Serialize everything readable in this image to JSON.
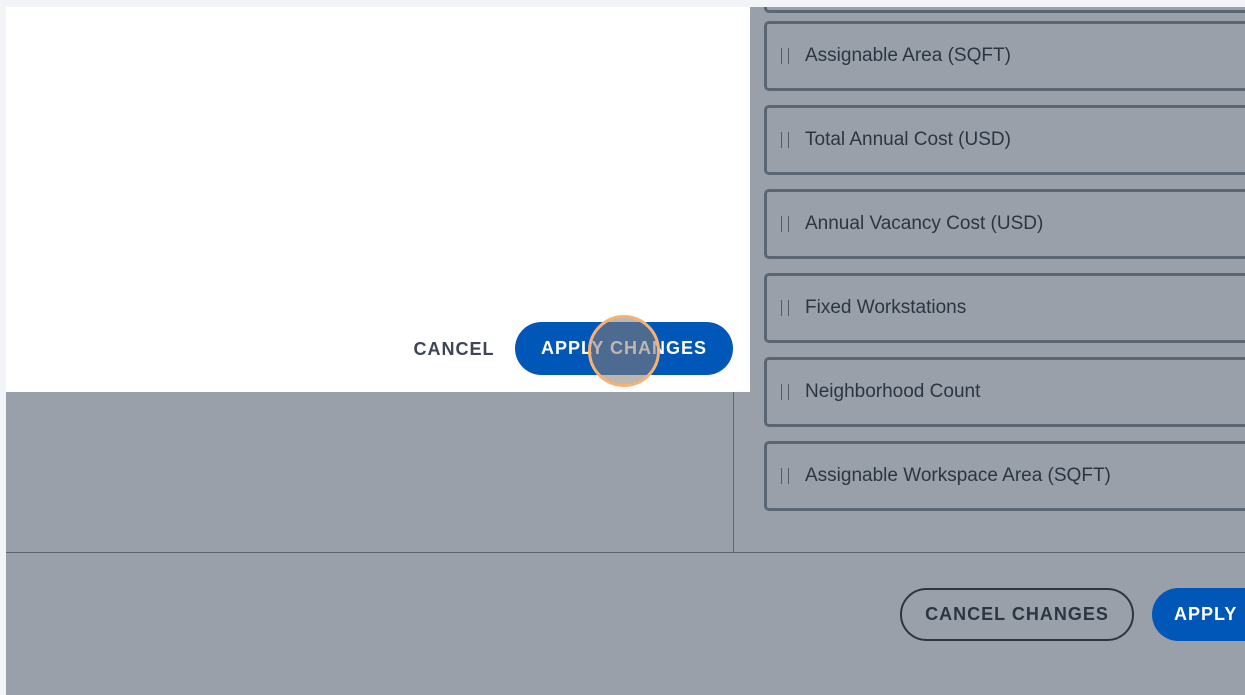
{
  "columns": {
    "items": [
      {
        "label": "Assignable Area (SQFT)"
      },
      {
        "label": "Total Annual Cost (USD)"
      },
      {
        "label": "Annual Vacancy Cost (USD)"
      },
      {
        "label": "Fixed Workstations"
      },
      {
        "label": "Neighborhood Count"
      },
      {
        "label": "Assignable Workspace Area (SQFT)"
      }
    ]
  },
  "dialog": {
    "cancel_label": "CANCEL",
    "apply_label": "APPLY CHANGES"
  },
  "footer": {
    "cancel_label": "CANCEL CHANGES",
    "apply_label": "APPLY"
  },
  "colors": {
    "primary": "#0057b8",
    "overlay": "#99a0a9",
    "border": "#5b6675"
  }
}
